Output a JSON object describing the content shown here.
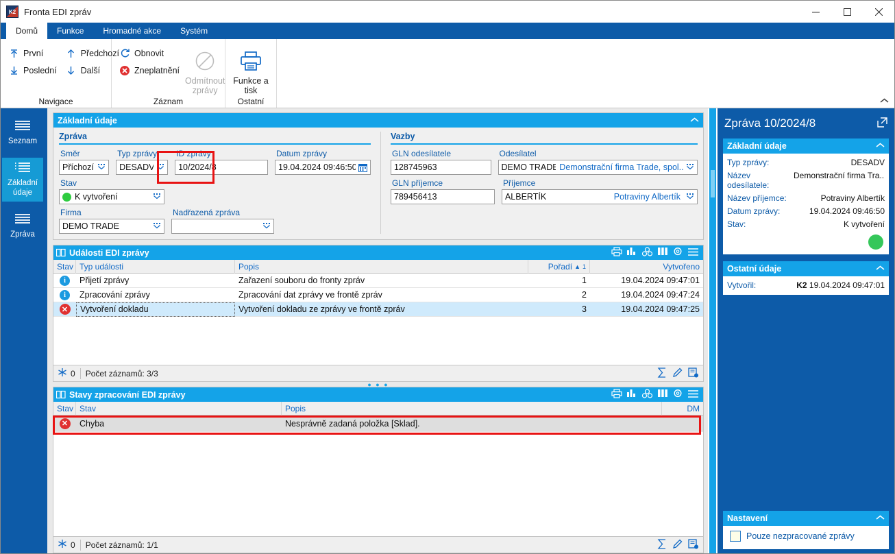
{
  "window": {
    "title": "Fronta EDI zpráv",
    "logo_text": "K2",
    "minimize": "—",
    "maximize": "☐",
    "close": "✕"
  },
  "ribbon": {
    "tabs": [
      {
        "label": "Domů",
        "active": true
      },
      {
        "label": "Funkce",
        "active": false
      },
      {
        "label": "Hromadné akce",
        "active": false
      },
      {
        "label": "Systém",
        "active": false
      }
    ],
    "groups": [
      {
        "name": "Navigace",
        "label": "Navigace",
        "items": [
          {
            "label": "První",
            "icon": "first-arrow-icon"
          },
          {
            "label": "Poslední",
            "icon": "last-arrow-icon"
          },
          {
            "label": "Předchozí",
            "icon": "up-arrow-icon"
          },
          {
            "label": "Další",
            "icon": "down-arrow-icon"
          }
        ]
      },
      {
        "name": "Záznam",
        "label": "Záznam",
        "items": [
          {
            "label": "Obnovit",
            "icon": "refresh-icon"
          },
          {
            "label": "Zneplatnění",
            "icon": "invalidate-icon"
          }
        ],
        "big": {
          "label_line1": "Odmítnout",
          "label_line2": "zprávy",
          "icon": "forbidden-icon",
          "disabled": true
        }
      },
      {
        "name": "Ostatní",
        "label": "Ostatní",
        "big": {
          "label_line1": "Funkce a",
          "label_line2": "tisk",
          "icon": "printer-icon",
          "disabled": false
        }
      }
    ],
    "collapse_chevron": "⌃"
  },
  "leftnav": {
    "items": [
      {
        "label": "Seznam",
        "icon": "list-lines-icon",
        "active": false
      },
      {
        "label_line1": "Základní",
        "label_line2": "údaje",
        "icon": "bullet-list-icon",
        "active": true
      },
      {
        "label": "Zpráva",
        "icon": "list-lines-icon",
        "active": false
      }
    ]
  },
  "basic_panel": {
    "header": "Základní údaje",
    "chevron": "⌃",
    "message_group": {
      "title": "Zpráva",
      "fields": {
        "smer": {
          "label": "Směr",
          "value": "Příchozí"
        },
        "typ_zpravy": {
          "label": "Typ zprávy",
          "value": "DESADV",
          "highlighted": true
        },
        "id_zpravy": {
          "label": "ID zprávy",
          "value": "10/2024/8"
        },
        "datum_zpravy": {
          "label": "Datum zprávy",
          "value": "19.04.2024 09:46:50"
        },
        "stav": {
          "label": "Stav",
          "value": "K vytvoření",
          "dot_color": "#2ecc40"
        },
        "firma": {
          "label": "Firma",
          "value": "DEMO TRADE"
        },
        "nadrazena_zprava": {
          "label": "Nadřazená zpráva",
          "value": ""
        }
      }
    },
    "links_group": {
      "title": "Vazby",
      "fields": {
        "gln_odesilatele": {
          "label": "GLN odesílatele",
          "value": "128745963"
        },
        "odesilatel": {
          "label": "Odesílatel",
          "value": "DEMO TRADE",
          "value2": "Demonstrační firma Trade, spol...."
        },
        "gln_prijemce": {
          "label": "GLN příjemce",
          "value": "789456413"
        },
        "prijemce": {
          "label": "Příjemce",
          "value": "ALBERTÍK",
          "value2": "Potraviny Albertík"
        }
      }
    }
  },
  "events_grid": {
    "title": "Události EDI zprávy",
    "tools": [
      "print-icon",
      "chart-icon",
      "pivot-icon",
      "columns-icon",
      "gear-icon",
      "menu-icon"
    ],
    "columns": [
      "Stav",
      "Typ události",
      "Popis",
      "Pořadí",
      "Vytvořeno"
    ],
    "sort_column": "Pořadí",
    "sort_indicator": "▲",
    "sort_order": "1",
    "rows": [
      {
        "status": "info",
        "typ": "Přijetí zprávy",
        "popis": "Zařazení souboru do fronty zpráv",
        "poradi": "1",
        "vytvoreno": "19.04.2024 09:47:01",
        "selected": false
      },
      {
        "status": "info",
        "typ": "Zpracování zprávy",
        "popis": "Zpracování dat zprávy ve frontě zpráv",
        "poradi": "2",
        "vytvoreno": "19.04.2024 09:47:24",
        "selected": false
      },
      {
        "status": "error",
        "typ": "Vytvoření dokladu",
        "popis": "Vytvoření dokladu ze zprávy ve frontě zpráv",
        "poradi": "3",
        "vytvoreno": "19.04.2024 09:47:25",
        "selected": true
      }
    ],
    "footer": {
      "filter_count": "0",
      "record_count": "Počet záznamů: 3/3",
      "right_icons": [
        "sum-icon",
        "edit-icon",
        "new-record-icon"
      ]
    }
  },
  "states_grid": {
    "title": "Stavy zpracování EDI zprávy",
    "tools": [
      "print-icon",
      "chart-icon",
      "pivot-icon",
      "columns-icon",
      "gear-icon",
      "menu-icon"
    ],
    "columns": [
      "Stav",
      "Stav",
      "Popis",
      "DM"
    ],
    "rows": [
      {
        "status": "error",
        "stav": "Chyba",
        "popis": "Nesprávně zadaná položka [Sklad].",
        "dm": "",
        "highlighted": true
      }
    ],
    "footer": {
      "filter_count": "0",
      "record_count": "Počet záznamů: 1/1",
      "right_icons": [
        "sum-icon",
        "edit-icon",
        "new-record-icon"
      ]
    }
  },
  "rightbar": {
    "title": "Zpráva 10/2024/8",
    "expand_icon": "open-external-icon",
    "sections": [
      {
        "header": "Základní údaje",
        "chevron": "⌃",
        "rows": [
          {
            "label": "Typ zprávy:",
            "value": "DESADV"
          },
          {
            "label": "Název odesílatele:",
            "value": "Demonstrační firma Tra..."
          },
          {
            "label": "Název příjemce:",
            "value": "Potraviny Albertík"
          },
          {
            "label": "Datum zprávy:",
            "value": "19.04.2024 09:46:50"
          },
          {
            "label": "Stav:",
            "value": "K vytvoření"
          }
        ],
        "status_dot_color": "#35c75a"
      },
      {
        "header": "Ostatní údaje",
        "chevron": "⌃",
        "rows": [
          {
            "label": "Vytvořil:",
            "value_bold": "K2",
            "value": "19.04.2024 09:47:01"
          }
        ]
      }
    ],
    "settings": {
      "header": "Nastavení",
      "chevron": "⌃",
      "checkbox_label": "Pouze nezpracované zprávy",
      "checked": false
    }
  },
  "colors": {
    "brand_dark_blue": "#0d5ba8",
    "brand_light_blue": "#14a3e8",
    "accent_text_blue": "#1069c6",
    "error_red": "#e81313",
    "status_green": "#2ecc40"
  }
}
